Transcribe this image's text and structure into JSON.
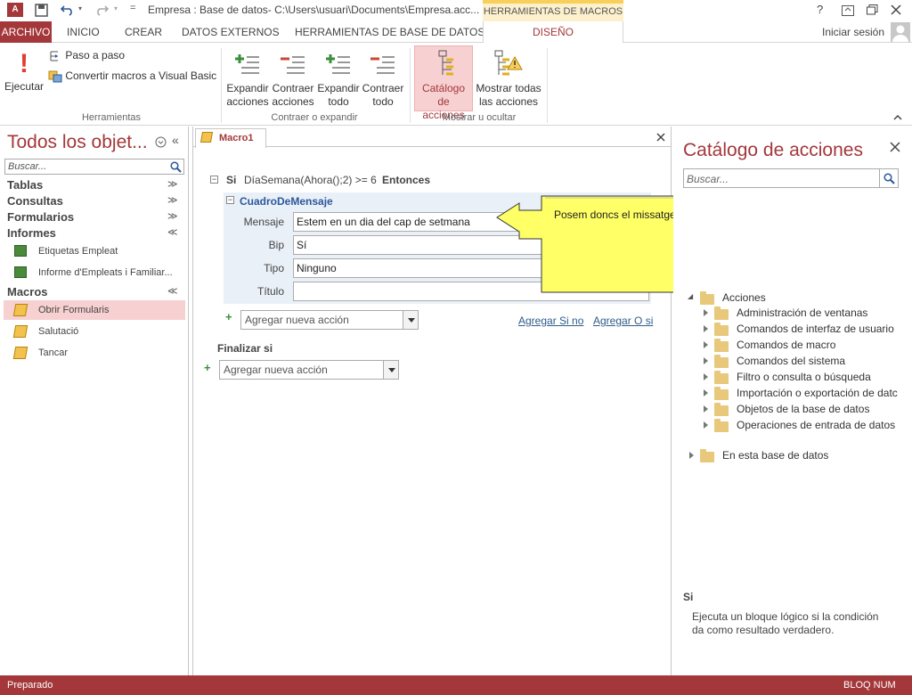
{
  "titlebar": {
    "title": "Empresa : Base de datos- C:\\Users\\usuari\\Documents\\Empresa.acc...",
    "context_tab": "HERRAMIENTAS DE MACROS",
    "help": "?",
    "qat_more": "="
  },
  "tabs": {
    "archivo": "ARCHIVO",
    "inicio": "INICIO",
    "crear": "CREAR",
    "datos_externos": "DATOS EXTERNOS",
    "herramientas_bd": "HERRAMIENTAS DE BASE DE DATOS",
    "diseno": "DISEÑO",
    "signin": "Iniciar sesión"
  },
  "ribbon": {
    "ejecutar": "Ejecutar",
    "paso_a_paso": "Paso a paso",
    "convertir": "Convertir macros a Visual Basic",
    "grp_herramientas": "Herramientas",
    "expandir_acciones": [
      "Expandir",
      "acciones"
    ],
    "contraer_acciones": [
      "Contraer",
      "acciones"
    ],
    "expandir_todo": [
      "Expandir",
      "todo"
    ],
    "contraer_todo": [
      "Contraer",
      "todo"
    ],
    "grp_contraer": "Contraer o expandir",
    "catalogo": [
      "Catálogo",
      "de acciones"
    ],
    "mostrar_todas": [
      "Mostrar todas",
      "las acciones"
    ],
    "grp_mostrar": "Mostrar u ocultar"
  },
  "nav": {
    "title": "Todos los objet...",
    "search_placeholder": "Buscar...",
    "tablas": "Tablas",
    "consultas": "Consultas",
    "formularios": "Formularios",
    "informes": "Informes",
    "informes_items": [
      "Etiquetas Empleat",
      "Informe d'Empleats i Familiar..."
    ],
    "macros": "Macros",
    "macro_items": [
      "Obrir Formularis",
      "Salutació",
      "Tancar"
    ]
  },
  "doc": {
    "tab": "Macro1",
    "si": "Si",
    "condition": "DíaSemana(Ahora();2) >= 6",
    "entonces": "Entonces",
    "action": "CuadroDeMensaje",
    "mensaje_label": "Mensaje",
    "mensaje_value": "Estem en un dia del cap de setmana",
    "bip_label": "Bip",
    "bip_value": "Sí",
    "tipo_label": "Tipo",
    "tipo_value": "Ninguno",
    "titulo_label": "Título",
    "titulo_value": "",
    "add_action": "Agregar nueva acción",
    "add_si_no": "Agregar Si no",
    "add_o_si": "Agregar O si",
    "finalizar": "Finalizar si",
    "add_action2": "Agregar nueva acción",
    "callout": "Posem doncs el missatge ..."
  },
  "catalog": {
    "title": "Catálogo de acciones",
    "search_placeholder": "Buscar...",
    "acciones": "Acciones",
    "folders": [
      "Administración de ventanas",
      "Comandos de interfaz de usuario",
      "Comandos de macro",
      "Comandos del sistema",
      "Filtro o consulta o búsqueda",
      "Importación o exportación de datc",
      "Objetos de la base de datos",
      "Operaciones de entrada de datos"
    ],
    "en_esta": "En esta base de datos",
    "help_title": "Si",
    "help_text": [
      "Ejecuta un bloque lógico si la condición",
      "da como resultado verdadero."
    ]
  },
  "status": {
    "left": "Preparado",
    "right": "BLOQ NUM"
  },
  "colors": {
    "access_red": "#a4373a",
    "context_yellow": "#f8cf5a",
    "callout_yellow": "#ffff66"
  }
}
